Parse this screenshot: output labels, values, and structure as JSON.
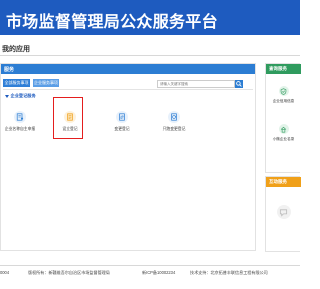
{
  "header": {
    "title": "市场监督管理局公众服务平台"
  },
  "page": {
    "title": "我的应用"
  },
  "main_panel": {
    "title": "服务",
    "filters": [
      {
        "label": "全部服务事项",
        "active": true
      },
      {
        "label": "企业服务事项",
        "active": false
      }
    ],
    "search": {
      "placeholder": "请输入关键字搜索",
      "icon": "search-icon"
    },
    "section": {
      "title": "企业登记服务"
    },
    "apps": [
      {
        "label": "企业名称自主申报",
        "icon": "document-person-icon",
        "color": "#2c7dd3"
      },
      {
        "label": "设立登记",
        "icon": "folder-doc-icon",
        "color": "#f0a019"
      },
      {
        "label": "变更登记",
        "icon": "exchange-doc-icon",
        "color": "#2c7dd3"
      },
      {
        "label": "只跑变更登记",
        "icon": "doc-refresh-icon",
        "color": "#2c7dd3"
      }
    ]
  },
  "side_cards": [
    {
      "title": "查询服务",
      "color": "#2f9b5e",
      "items": [
        {
          "label": "企业信用信息",
          "icon": "shield-check-icon",
          "color": "#2f9b5e"
        },
        {
          "label": "小微企业名录",
          "icon": "house-icon",
          "color": "#2f9b5e"
        }
      ]
    },
    {
      "title": "互动服务",
      "color": "#f0a019",
      "items": [
        {
          "label": "",
          "icon": "chat-bubble-icon",
          "color": "#cccccc"
        }
      ]
    }
  ],
  "footer": {
    "hotline": "0004",
    "copyright": "版权所有：新疆维吾尔自治区市场监督管理局",
    "icp": "新ICP备10002234",
    "support": "技术支持：北京拓普丰联信息工程有限公司"
  }
}
